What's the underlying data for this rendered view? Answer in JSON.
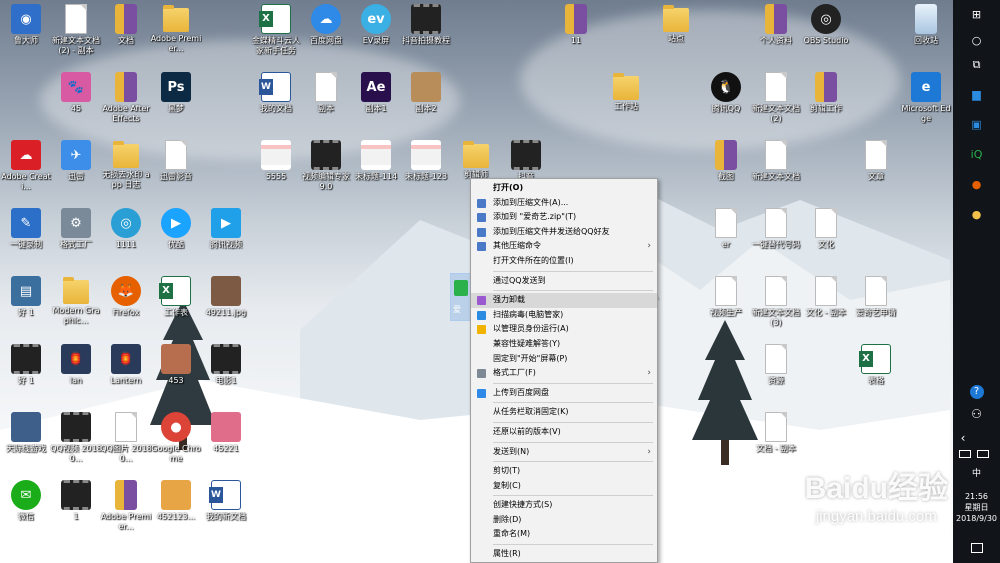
{
  "desktop_icons": [
    {
      "label": "鲁大师",
      "kind": "thumb",
      "color": "#2f6fc9",
      "glyph": "◉"
    },
    {
      "label": "新建文本文档 (2) - 副本",
      "kind": "doc"
    },
    {
      "label": "文档",
      "kind": "book"
    },
    {
      "label": "Adobe Premier...",
      "kind": "folder"
    },
    {
      "label": "金蝶精斗云人家新手任务",
      "kind": "excel"
    },
    {
      "label": "百度网盘",
      "kind": "round",
      "color": "#2e8ae6",
      "glyph": "☁"
    },
    {
      "label": "EV录屏",
      "kind": "round",
      "color": "#3ab0e5",
      "glyph": "ev"
    },
    {
      "label": "抖音拍摄教程",
      "kind": "film"
    },
    {
      "label": "11",
      "kind": "book"
    },
    {
      "label": "站点",
      "kind": "folder"
    },
    {
      "label": "个人资料",
      "kind": "book"
    },
    {
      "label": "OBS Studio",
      "kind": "round",
      "color": "#222",
      "glyph": "◎"
    },
    {
      "label": "回收站",
      "kind": "recycle"
    },
    {
      "label": "45",
      "kind": "thumb",
      "color": "#d85aa3",
      "glyph": "🐾"
    },
    {
      "label": "Adobe After Effects",
      "kind": "book"
    },
    {
      "label": "黑梦",
      "kind": "thumb",
      "color": "#0d2a44",
      "glyph": "Ps"
    },
    {
      "label": "我的文档",
      "kind": "word"
    },
    {
      "label": "副本",
      "kind": "doc"
    },
    {
      "label": "副本1",
      "kind": "thumb",
      "color": "#2a0f4d",
      "glyph": "Ae"
    },
    {
      "label": "副本2",
      "kind": "thumb",
      "color": "#b88d5a",
      "glyph": ""
    },
    {
      "label": "工作站",
      "kind": "folder"
    },
    {
      "label": "腾讯QQ",
      "kind": "round",
      "color": "#111",
      "glyph": "🐧"
    },
    {
      "label": "新建文本文档 (2)",
      "kind": "doc"
    },
    {
      "label": "剪辑工作",
      "kind": "book"
    },
    {
      "label": "Microsoft Edge",
      "kind": "thumb",
      "color": "#1e78d6",
      "glyph": "e"
    },
    {
      "label": "Adobe Creati...",
      "kind": "thumb",
      "color": "#da1f26",
      "glyph": "☁"
    },
    {
      "label": "迅雷",
      "kind": "thumb",
      "color": "#3c8ee8",
      "glyph": "✈"
    },
    {
      "label": "无损去水印 app 日志",
      "kind": "folder"
    },
    {
      "label": "迅雷影音",
      "kind": "doc"
    },
    {
      "label": "5555",
      "kind": "strip"
    },
    {
      "label": "视频编辑专家 9.0",
      "kind": "film"
    },
    {
      "label": "未标题-114",
      "kind": "strip"
    },
    {
      "label": "未标题-123",
      "kind": "strip"
    },
    {
      "label": "剪辑师",
      "kind": "folder"
    },
    {
      "label": "抖音",
      "kind": "film"
    },
    {
      "label": "截图",
      "kind": "book"
    },
    {
      "label": "新建文本文档",
      "kind": "doc"
    },
    {
      "label": "文章",
      "kind": "doc"
    },
    {
      "label": "一键录制",
      "kind": "thumb",
      "color": "#2b6fc8",
      "glyph": "✎"
    },
    {
      "label": "格式工厂",
      "kind": "thumb",
      "color": "#7a8a99",
      "glyph": "⚙"
    },
    {
      "label": "1111",
      "kind": "round",
      "color": "#2a9fd6",
      "glyph": "◎"
    },
    {
      "label": "优酷",
      "kind": "round",
      "color": "#1aa3ff",
      "glyph": "▶"
    },
    {
      "label": "腾讯视频",
      "kind": "thumb",
      "color": "#1fa0e8",
      "glyph": "▶"
    },
    {
      "label": "er",
      "kind": "doc"
    },
    {
      "label": "一键替代号码",
      "kind": "doc"
    },
    {
      "label": "文化",
      "kind": "doc"
    },
    {
      "label": "好 1",
      "kind": "thumb",
      "color": "#3a6f9e",
      "glyph": "▤"
    },
    {
      "label": "Modern Graphic...",
      "kind": "folder"
    },
    {
      "label": "Firefox",
      "kind": "round",
      "color": "#e66000",
      "glyph": "🦊"
    },
    {
      "label": "工作表",
      "kind": "excel"
    },
    {
      "label": "49211.jpg",
      "kind": "thumb",
      "color": "#7d5a44",
      "glyph": ""
    },
    {
      "label": "视频生产",
      "kind": "doc"
    },
    {
      "label": "新建文本文档 (3)",
      "kind": "doc"
    },
    {
      "label": "文化 - 副本",
      "kind": "doc"
    },
    {
      "label": "爱奇艺申请",
      "kind": "doc"
    },
    {
      "label": "好 1",
      "kind": "film"
    },
    {
      "label": "lan",
      "kind": "thumb",
      "color": "#2a3a5a",
      "glyph": "🏮"
    },
    {
      "label": "Lantern",
      "kind": "thumb",
      "color": "#2a3a5a",
      "glyph": "🏮"
    },
    {
      "label": "453",
      "kind": "thumb",
      "color": "#b66e4f",
      "glyph": ""
    },
    {
      "label": "电影1",
      "kind": "film"
    },
    {
      "label": "资源",
      "kind": "doc"
    },
    {
      "label": "表格",
      "kind": "excel"
    },
    {
      "label": "天际线游戏",
      "kind": "thumb",
      "color": "#3e5f8a",
      "glyph": ""
    },
    {
      "label": "QQ视频 20180...",
      "kind": "film"
    },
    {
      "label": "QQ图片 20180...",
      "kind": "doc"
    },
    {
      "label": "Google Chrome",
      "kind": "round",
      "color": "#db4437",
      "glyph": "●"
    },
    {
      "label": "45221",
      "kind": "thumb",
      "color": "#e06e8a",
      "glyph": ""
    },
    {
      "label": "文档 - 副本",
      "kind": "doc"
    },
    {
      "label": "微信",
      "kind": "round",
      "color": "#1aad19",
      "glyph": "✉"
    },
    {
      "label": "1",
      "kind": "film"
    },
    {
      "label": "Adobe Premier...",
      "kind": "book"
    },
    {
      "label": "452123...",
      "kind": "thumb",
      "color": "#e7a545",
      "glyph": ""
    },
    {
      "label": "我的新文档",
      "kind": "word"
    }
  ],
  "context_menu": {
    "groups": [
      [
        {
          "label": "打开(O)",
          "bold": true,
          "icon": "",
          "color": ""
        },
        {
          "label": "添加到压缩文件(A)...",
          "icon": "zip-icon",
          "color": "#4a79c8"
        },
        {
          "label": "添加到 \"爱奇艺.zip\"(T)",
          "icon": "zip-icon",
          "color": "#4a79c8"
        },
        {
          "label": "添加到压缩文件并发送给QQ好友",
          "icon": "zip-icon",
          "color": "#4a79c8"
        },
        {
          "label": "其他压缩命令",
          "icon": "zip-icon",
          "color": "#4a79c8",
          "submenu": true
        },
        {
          "label": "打开文件所在的位置(I)",
          "icon": "",
          "color": ""
        }
      ],
      [
        {
          "label": "通过QQ发送到",
          "icon": "",
          "color": ""
        }
      ],
      [
        {
          "label": "强力卸载",
          "icon": "uninstall-icon",
          "color": "#9b59d0",
          "highlight": true
        },
        {
          "label": "扫描病毒(电脑管家)",
          "icon": "shield-icon",
          "color": "#2a8be0"
        },
        {
          "label": "以管理员身份运行(A)",
          "icon": "uac-shield-icon",
          "color": "#f0b400"
        },
        {
          "label": "兼容性疑难解答(Y)",
          "icon": "",
          "color": ""
        },
        {
          "label": "固定到\"开始\"屏幕(P)",
          "icon": "",
          "color": ""
        },
        {
          "label": "格式工厂(F)",
          "icon": "format-factory-icon",
          "color": "#7d8a96",
          "submenu": true
        }
      ],
      [
        {
          "label": "上传到百度网盘",
          "icon": "baidu-cloud-icon",
          "color": "#2e8ae6"
        }
      ],
      [
        {
          "label": "从任务栏取消固定(K)",
          "icon": "",
          "color": ""
        }
      ],
      [
        {
          "label": "还原以前的版本(V)",
          "icon": "",
          "color": ""
        }
      ],
      [
        {
          "label": "发送到(N)",
          "icon": "",
          "color": "",
          "submenu": true
        }
      ],
      [
        {
          "label": "剪切(T)",
          "icon": "",
          "color": ""
        },
        {
          "label": "复制(C)",
          "icon": "",
          "color": ""
        }
      ],
      [
        {
          "label": "创建快捷方式(S)",
          "icon": "",
          "color": ""
        },
        {
          "label": "删除(D)",
          "icon": "",
          "color": ""
        },
        {
          "label": "重命名(M)",
          "icon": "",
          "color": ""
        }
      ],
      [
        {
          "label": "属性(R)",
          "icon": "",
          "color": ""
        }
      ]
    ]
  },
  "selected_icon_label": "爱",
  "taskbar": {
    "icons": [
      {
        "name": "windows-start-icon",
        "glyph": "⊞",
        "color": "#ffffff"
      },
      {
        "name": "cortana-icon",
        "glyph": "○",
        "color": "#ffffff"
      },
      {
        "name": "task-view-icon",
        "glyph": "⧉",
        "color": "#ffffff"
      },
      {
        "name": "file-explorer-icon",
        "glyph": "▆",
        "color": "#2a8be0"
      },
      {
        "name": "store-icon",
        "glyph": "▣",
        "color": "#2a8be0"
      },
      {
        "name": "iqiyi-icon",
        "glyph": "iQ",
        "color": "#2ab14a"
      },
      {
        "name": "firefox-icon",
        "glyph": "●",
        "color": "#e66000"
      },
      {
        "name": "app-icon",
        "glyph": "●",
        "color": "#f0c24b"
      }
    ],
    "tray": {
      "help": "?",
      "people": "⚇",
      "chevron": "‹",
      "ime": "中"
    },
    "time": "21:56",
    "weekday": "星期日",
    "date": "2018/9/30"
  },
  "watermark": {
    "brand": "Baidu经验",
    "url": "jingyan.baidu.com"
  }
}
